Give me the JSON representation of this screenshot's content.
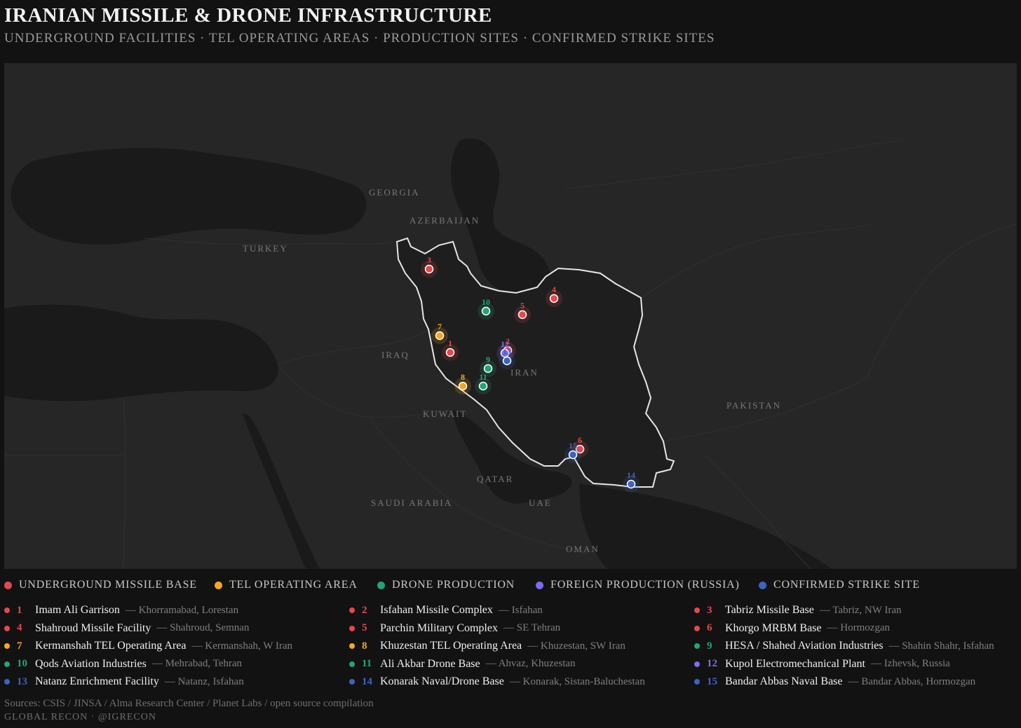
{
  "title": "IRANIAN MISSILE & DRONE INFRASTRUCTURE",
  "subtitle": "UNDERGROUND FACILITIES · TEL OPERATING AREAS · PRODUCTION SITES · CONFIRMED STRIKE SITES",
  "colors": {
    "underground": "#e5484d",
    "tel": "#f5a623",
    "drone": "#1fa57a",
    "foreign": "#7b6cf0",
    "strike": "#3b64c4",
    "border": "#e6e6e6",
    "land": "#242424",
    "sea": "#1a1a1a"
  },
  "legend": [
    {
      "label": "UNDERGROUND MISSILE BASE",
      "category": "underground"
    },
    {
      "label": "TEL OPERATING AREA",
      "category": "tel"
    },
    {
      "label": "DRONE PRODUCTION",
      "category": "drone"
    },
    {
      "label": "FOREIGN PRODUCTION (RUSSIA)",
      "category": "foreign"
    },
    {
      "label": "CONFIRMED STRIKE SITE",
      "category": "strike"
    }
  ],
  "countries": [
    "GEORGIA",
    "AZERBAIJAN",
    "TURKEY",
    "IRAQ",
    "IRAN",
    "KUWAIT",
    "PAKISTAN",
    "QATAR",
    "SAUDI ARABIA",
    "UAE",
    "OMAN"
  ],
  "sites": [
    {
      "num": "1",
      "name": "Imam Ali Garrison",
      "loc": "— Khorramabad, Lorestan",
      "category": "underground"
    },
    {
      "num": "2",
      "name": "Isfahan Missile Complex",
      "loc": "— Isfahan",
      "category": "underground"
    },
    {
      "num": "3",
      "name": "Tabriz Missile Base",
      "loc": "— Tabriz, NW Iran",
      "category": "underground"
    },
    {
      "num": "4",
      "name": "Shahroud Missile Facility",
      "loc": "— Shahroud, Semnan",
      "category": "underground"
    },
    {
      "num": "5",
      "name": "Parchin Military Complex",
      "loc": "— SE Tehran",
      "category": "underground"
    },
    {
      "num": "6",
      "name": "Khorgo MRBM Base",
      "loc": "— Hormozgan",
      "category": "underground"
    },
    {
      "num": "7",
      "name": "Kermanshah TEL Operating Area",
      "loc": "— Kermanshah, W Iran",
      "category": "tel"
    },
    {
      "num": "8",
      "name": "Khuzestan TEL Operating Area",
      "loc": "— Khuzestan, SW Iran",
      "category": "tel"
    },
    {
      "num": "9",
      "name": "HESA / Shahed Aviation Industries",
      "loc": "— Shahin Shahr, Isfahan",
      "category": "drone"
    },
    {
      "num": "10",
      "name": "Qods Aviation Industries",
      "loc": "— Mehrabad, Tehran",
      "category": "drone"
    },
    {
      "num": "11",
      "name": "Ali Akbar Drone Base",
      "loc": "— Ahvaz, Khuzestan",
      "category": "drone"
    },
    {
      "num": "12",
      "name": "Kupol Electromechanical Plant",
      "loc": "— Izhevsk, Russia",
      "category": "foreign"
    },
    {
      "num": "13",
      "name": "Natanz Enrichment Facility",
      "loc": "— Natanz, Isfahan",
      "category": "strike"
    },
    {
      "num": "14",
      "name": "Konarak Naval/Drone Base",
      "loc": "— Konarak, Sistan-Baluchestan",
      "category": "strike"
    },
    {
      "num": "15",
      "name": "Bandar Abbas Naval Base",
      "loc": "— Bandar Abbas, Hormozgan",
      "category": "strike"
    }
  ],
  "sources": "Sources: CSIS / JINSA / Alma Research Center / Planet Labs / open source compilation",
  "brand": "GLOBAL RECON · @IGRECON"
}
